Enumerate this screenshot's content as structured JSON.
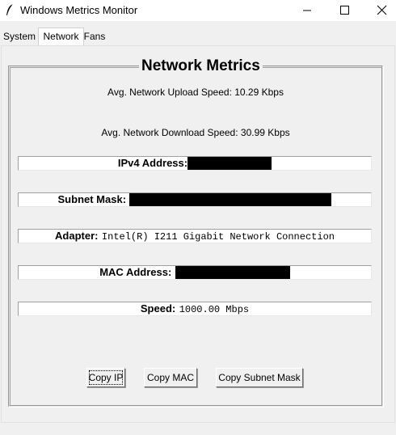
{
  "window": {
    "title": "Windows Metrics Monitor",
    "icon": "feather-icon",
    "controls": [
      "minimize-icon",
      "maximize-icon",
      "close-icon"
    ]
  },
  "tabs": [
    {
      "label": "System",
      "active": false
    },
    {
      "label": "Network",
      "active": true
    },
    {
      "label": "Fans",
      "active": false
    }
  ],
  "network": {
    "group_title": "Network Metrics",
    "upload": "Avg. Network Upload Speed: 10.29 Kbps",
    "download": "Avg. Network Download Speed: 30.99 Kbps",
    "ipv4": {
      "label": "IPv4 Address:",
      "value_redacted": true
    },
    "subnet": {
      "label": "Subnet Mask:",
      "value_redacted": true
    },
    "adapter": {
      "label": "Adapter:",
      "value": "Intel(R) I211 Gigabit Network Connection"
    },
    "mac": {
      "label": "MAC Address:",
      "value_redacted": true
    },
    "speed": {
      "label": "Speed:",
      "value": "1000.00 Mbps"
    }
  },
  "buttons": {
    "copy_ip": "Copy IP",
    "copy_mac": "Copy MAC",
    "copy_subnet": "Copy Subnet Mask"
  }
}
